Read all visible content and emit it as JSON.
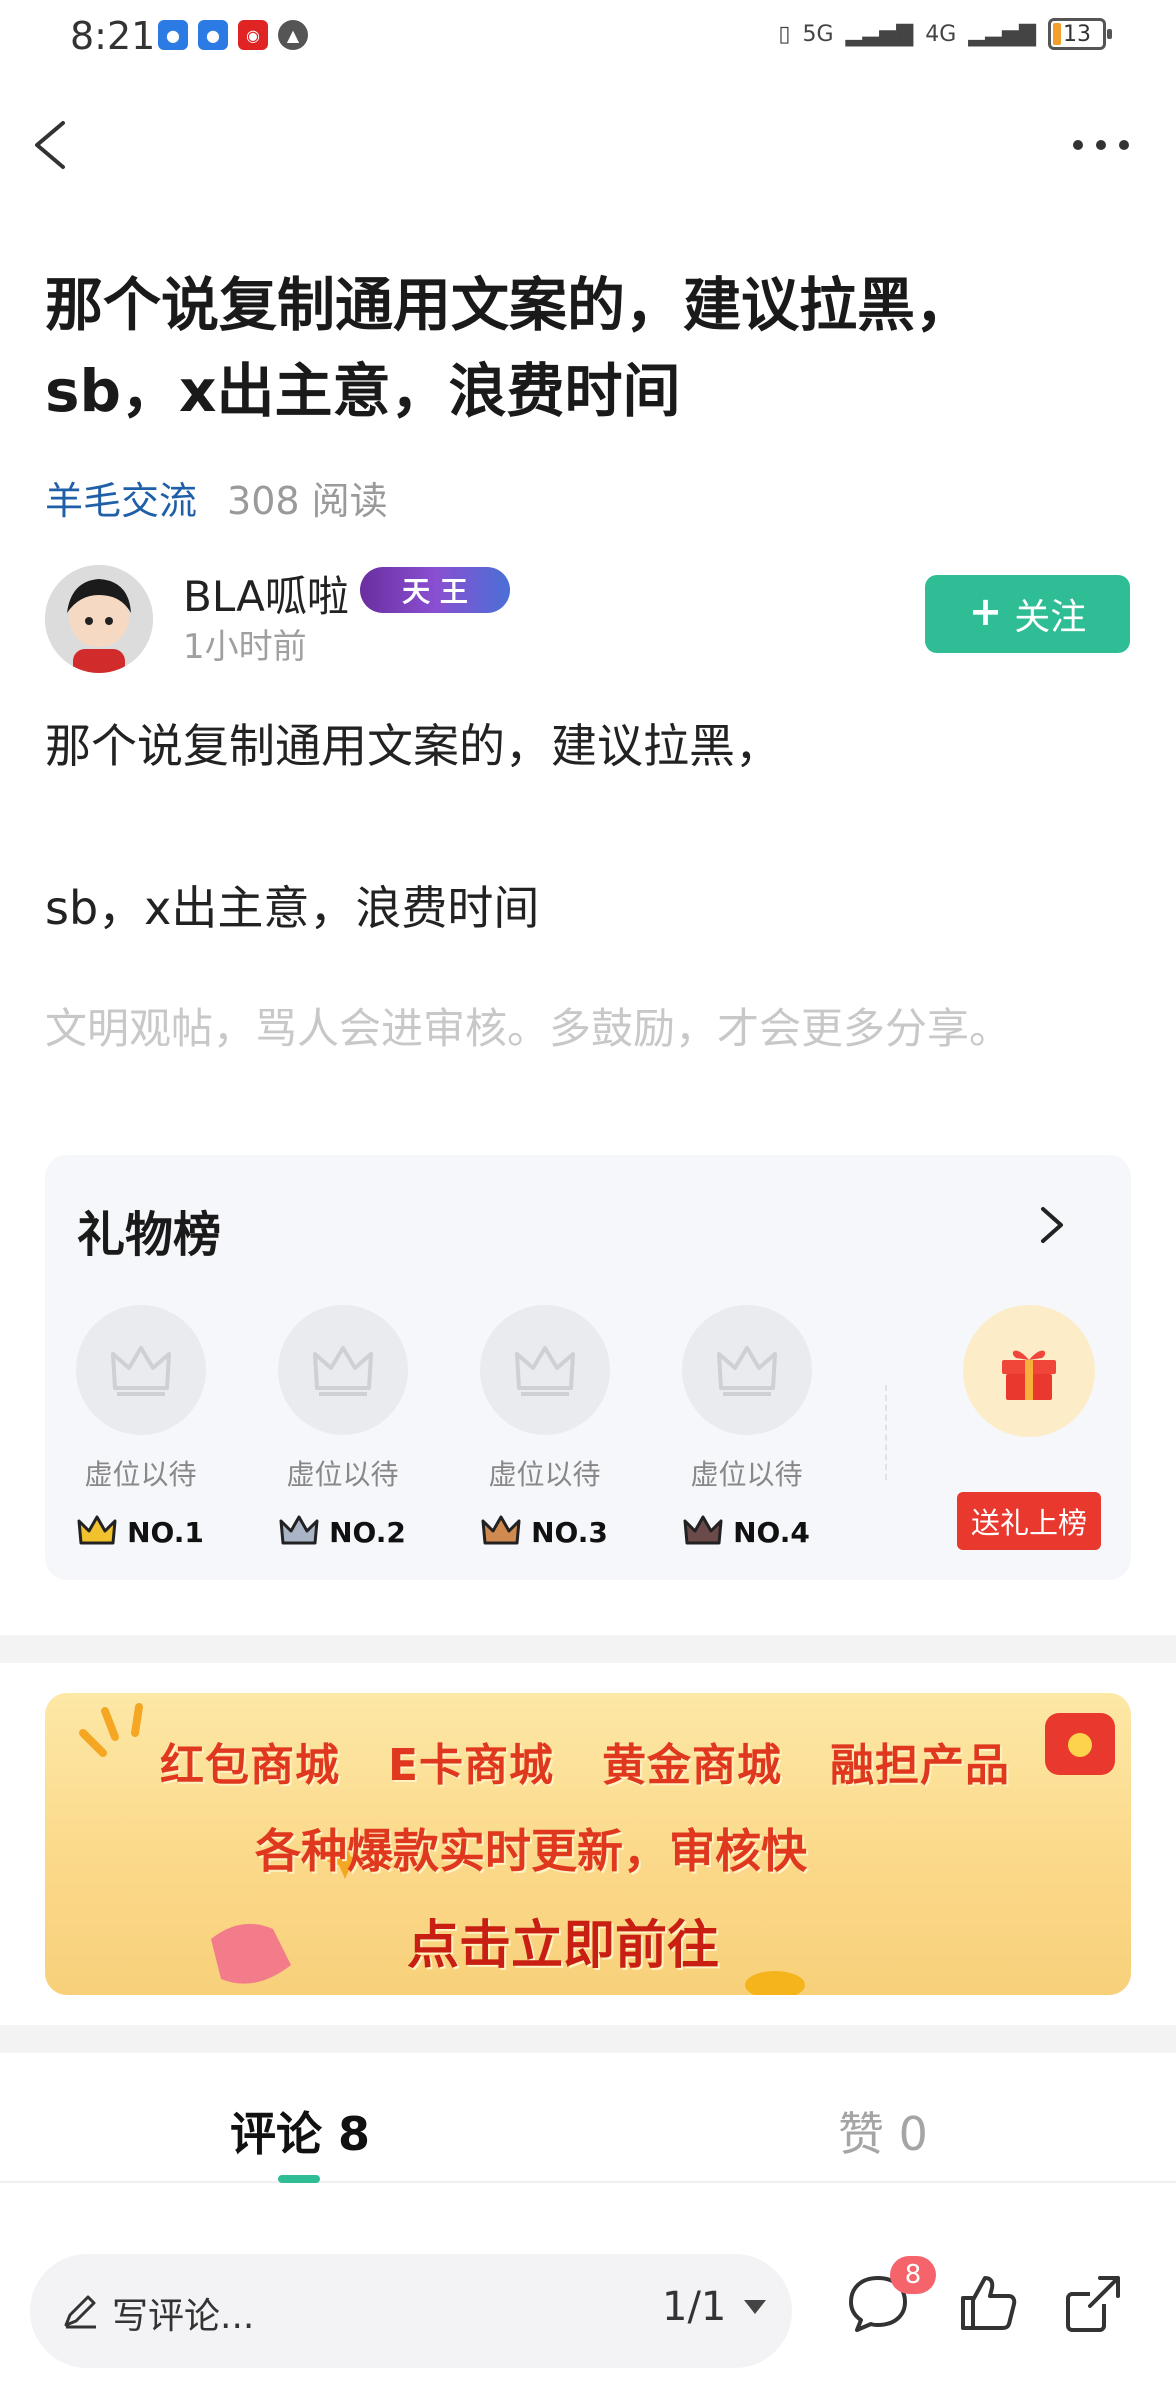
{
  "status_bar": {
    "time": "8:21",
    "network1": "5G",
    "network2": "4G",
    "battery": "13"
  },
  "post": {
    "title": "那个说复制通用文案的，建议拉黑，\nsb，x出主意，浪费时间",
    "category": "羊毛交流",
    "reads": "308 阅读",
    "author": {
      "name": "BLA呱啦",
      "badge": "天 王",
      "time": "1小时前"
    },
    "follow_label": "关注",
    "body_lines": [
      "那个说复制通用文案的，建议拉黑，",
      "sb，x出主意，浪费时间"
    ],
    "hint": "文明观帖，骂人会进审核。多鼓励，才会更多分享。"
  },
  "gift_board": {
    "title": "礼物榜",
    "slots": [
      {
        "label": "虚位以待",
        "rank": "NO.1",
        "crown_color": "#f2c12e"
      },
      {
        "label": "虚位以待",
        "rank": "NO.2",
        "crown_color": "#a9b4c6"
      },
      {
        "label": "虚位以待",
        "rank": "NO.3",
        "crown_color": "#d08a4f"
      },
      {
        "label": "虚位以待",
        "rank": "NO.4",
        "crown_color": "#6b4a4a"
      }
    ],
    "send_label": "送礼上榜"
  },
  "banner": {
    "items": [
      "红包商城",
      "E卡商城",
      "黄金商城",
      "融担产品"
    ],
    "line2": "各种爆款实时更新，审核快",
    "line3": "点击立即前往"
  },
  "tabs": {
    "comments": "评论 8",
    "likes": "赞 0"
  },
  "bottom_bar": {
    "placeholder": "写评论...",
    "pager": "1/1",
    "comment_count": "8"
  },
  "colors": {
    "accent": "#2ebd94",
    "link": "#1f5fa8",
    "gift_red": "#e9382e"
  }
}
